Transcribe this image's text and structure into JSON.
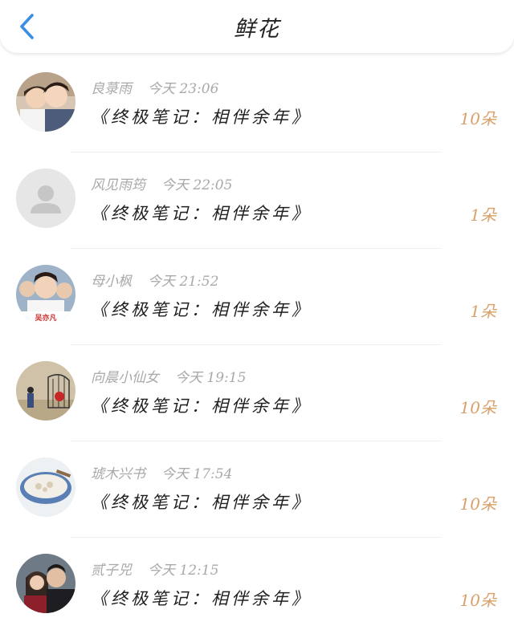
{
  "header": {
    "title": "鲜花"
  },
  "rows": [
    {
      "user": "良菉雨",
      "time": "今天 23:06",
      "book": "《终极笔记：相伴余年》",
      "count": "10朵"
    },
    {
      "user": "风见雨筠",
      "time": "今天 22:05",
      "book": "《终极笔记：相伴余年》",
      "count": "1朵"
    },
    {
      "user": "母小枫",
      "time": "今天 21:52",
      "book": "《终极笔记：相伴余年》",
      "count": "1朵"
    },
    {
      "user": "向晨小仙女",
      "time": "今天 19:15",
      "book": "《终极笔记：相伴余年》",
      "count": "10朵"
    },
    {
      "user": "琥木兴书",
      "time": "今天 17:54",
      "book": "《终极笔记：相伴余年》",
      "count": "10朵"
    },
    {
      "user": "贰子兕",
      "time": "今天 12:15",
      "book": "《终极笔记：相伴余年》",
      "count": "10朵"
    }
  ],
  "colors": {
    "accent": "#3a8ee6",
    "count": "#d9a06a",
    "meta": "#a9a9a9"
  },
  "icons": {
    "back": "chevron-left-icon",
    "default_avatar": "user-silhouette-icon"
  }
}
